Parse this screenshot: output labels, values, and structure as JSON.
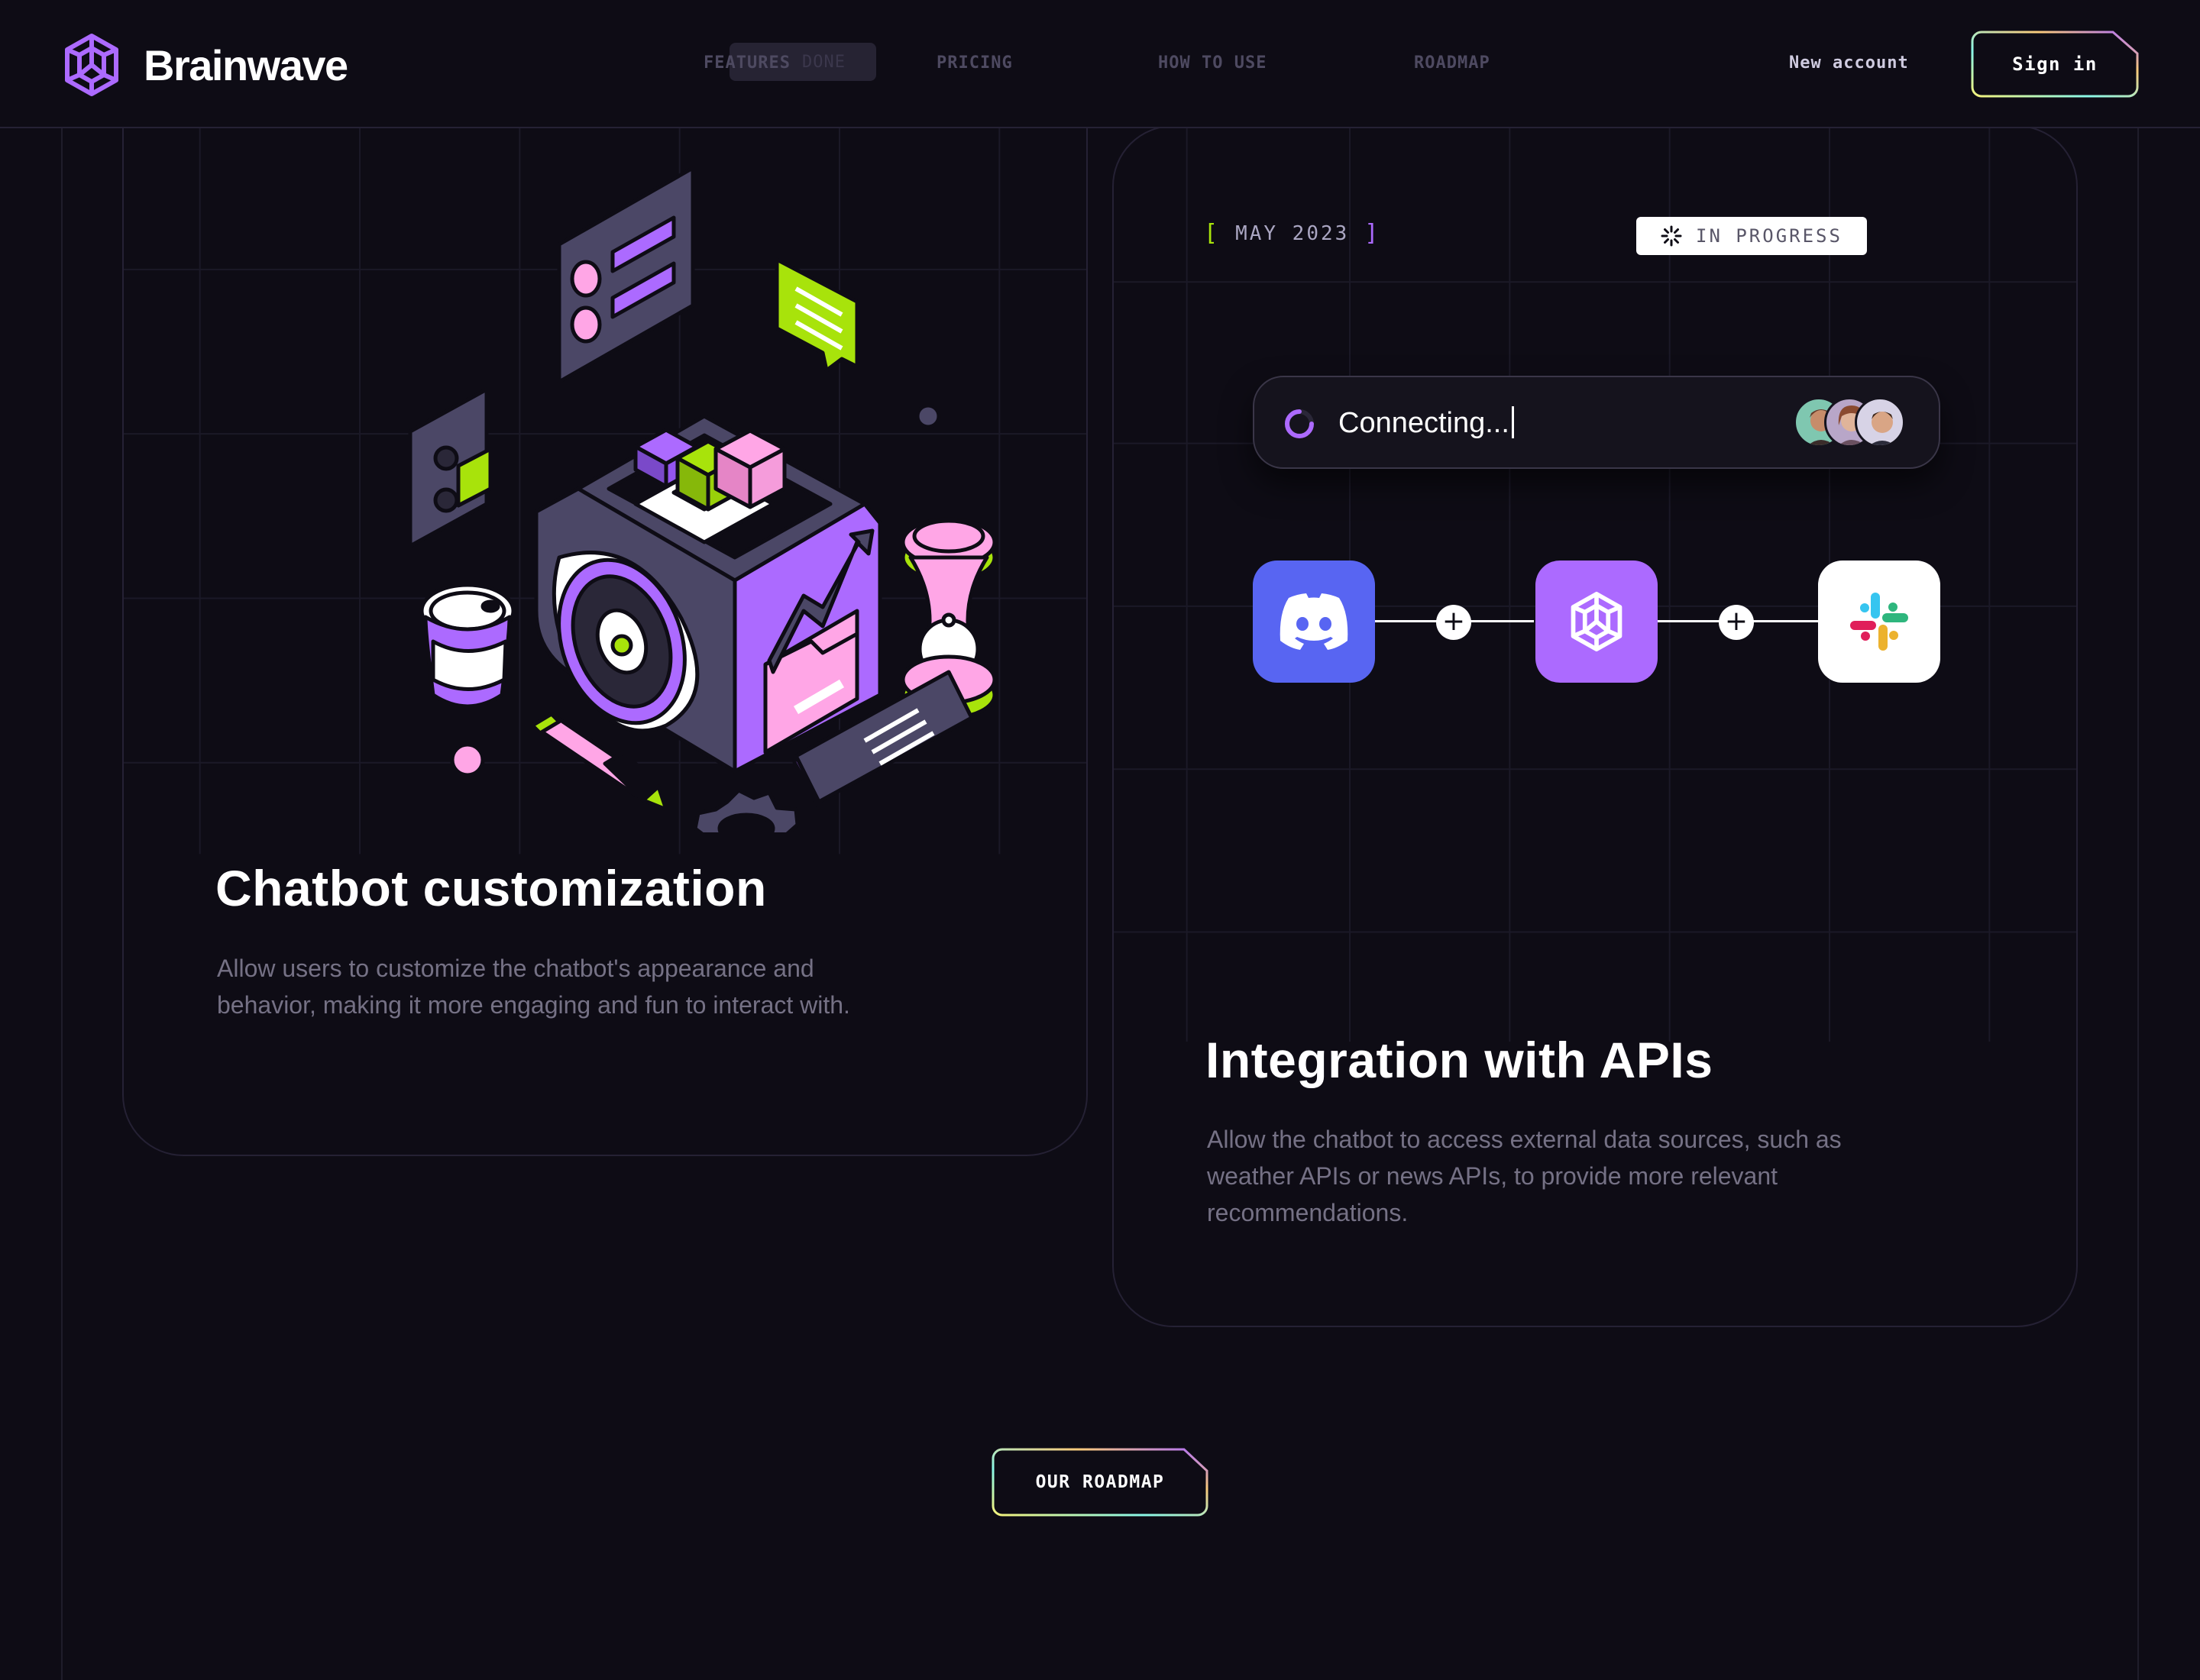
{
  "brand": {
    "name": "Brainwave",
    "accent": "#ac6aff",
    "lime": "#a8e30b",
    "background": "#0e0c15"
  },
  "nav": {
    "items": [
      "Features",
      "Pricing",
      "How to use",
      "Roadmap"
    ],
    "overlay_pill": "DONE",
    "new_account": "New account",
    "sign_in": "Sign in"
  },
  "cards": [
    {
      "title": "Chatbot customization",
      "description_lines": [
        "Allow users to customize the chatbot's appearance and",
        "behavior, making it more engaging and fun to interact with."
      ],
      "illustration": "isometric-cube-illustration"
    },
    {
      "date": "May 2023",
      "status": "In progress",
      "connecting_text": "Connecting...",
      "apps": [
        "discord-icon",
        "brainwave-icon",
        "slack-icon"
      ],
      "title": "Integration with APIs",
      "description_lines": [
        "Allow the chatbot to access external data sources, such as",
        "weather APIs or news APIs, to provide more relevant",
        "recommendations."
      ]
    }
  ],
  "cta": {
    "label": "Our roadmap"
  }
}
